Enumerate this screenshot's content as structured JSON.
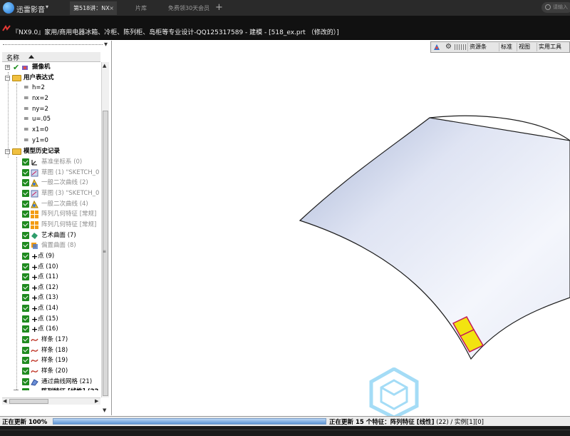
{
  "player": {
    "name": "迅雷影音",
    "caret": "▾",
    "tabs": {
      "video": "第518讲：NX",
      "library": "片库",
      "vip": "免费领30天会员"
    },
    "tab_close": "×",
    "add_tab": "+",
    "search_placeholder": "请输入"
  },
  "nx": {
    "title": "『NX9.0』家用/商用电器冰箱、冷柜、陈列柜、岛柜等专业设计-QQ125317589 - 建模 - [518_ex.prt （修改的）]"
  },
  "navigator": {
    "close": "▾",
    "column": "名称",
    "camera": "摄像机",
    "expressions_folder": "用户表达式",
    "expressions": [
      "h=2",
      "nx=2",
      "ny=2",
      "u=.05",
      "x1=0",
      "y1=0"
    ],
    "history_folder": "模型历史记录",
    "features": [
      "基准坐标系 (0)",
      "草图 (1) \"SKETCH_0",
      "一般二次曲线 (2)",
      "草图 (3) \"SKETCH_0",
      "一般二次曲线 (4)",
      "阵列几何特征 [常规]",
      "阵列几何特征 [常规]",
      "艺术曲面 (7)",
      "偏置曲面 (8)",
      "点 (9)",
      "点 (10)",
      "点 (11)",
      "点 (12)",
      "点 (13)",
      "点 (14)",
      "点 (15)",
      "点 (16)",
      "样条 (17)",
      "样条 (18)",
      "样条 (19)",
      "样条 (20)",
      "通过曲线网格 (21)",
      "阵列特征 [线性] (22"
    ],
    "scroll_up": "▲",
    "scroll_down": "▼",
    "scroll_left": "◀",
    "scroll_right": "▶",
    "scroll_grip": "≡",
    "expand_plus": "+",
    "expand_minus": "−"
  },
  "toolbar": {
    "gear": "⚙",
    "resources": "资源条",
    "standard": "标准",
    "view": "视图",
    "utility": "实用工具"
  },
  "status": {
    "left": "正在更新 100%",
    "progress": 1.0,
    "right_prefix": "正在更新 15 个特征：",
    "right_feature": "阵列特征 [线性]",
    "right_suffix": " (22) / 实例[1][0]"
  },
  "colors": {
    "surface_light": "#f2f4fb",
    "surface_dark": "#a9b6d6",
    "patch_fill": "#f2e310",
    "patch_edge": "#c2185b"
  }
}
